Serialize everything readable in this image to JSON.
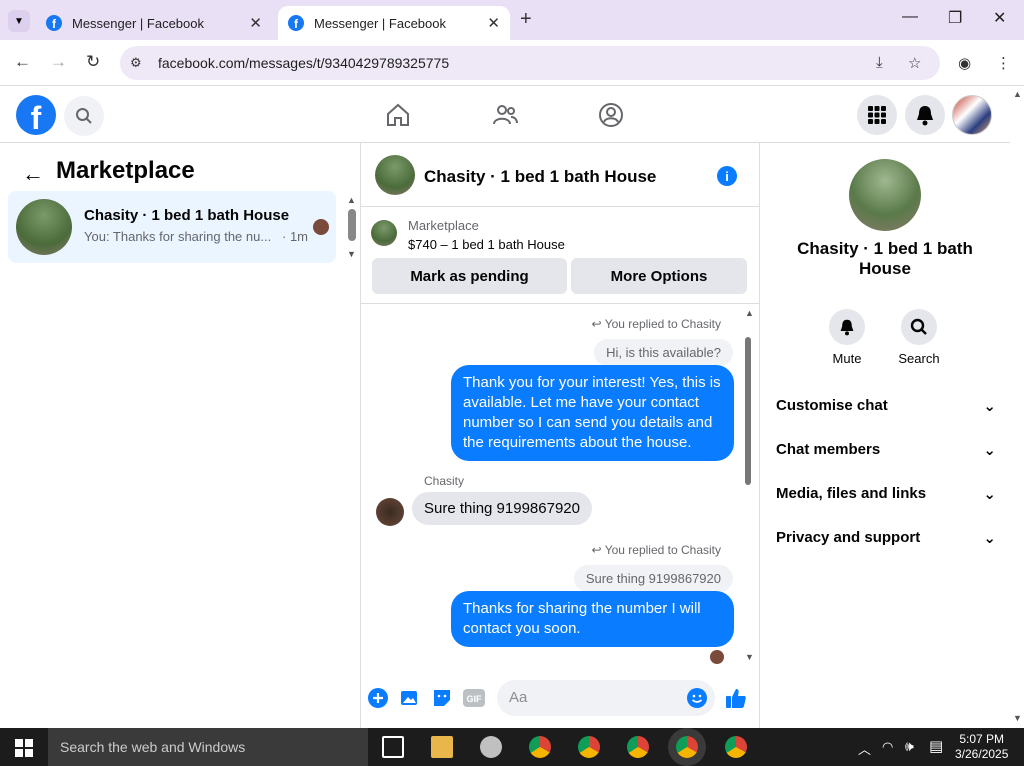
{
  "browser": {
    "tabs": [
      {
        "title": "Messenger | Facebook"
      },
      {
        "title": "Messenger | Facebook"
      }
    ],
    "url": "facebook.com/messages/t/9340429789325775"
  },
  "left_panel": {
    "title": "Marketplace",
    "conversation": {
      "title": "Chasity · 1 bed 1 bath House",
      "preview": "You: Thanks for sharing the nu...",
      "time": "· 1m"
    }
  },
  "chat": {
    "title": "Chasity · 1 bed 1 bath House",
    "listing": {
      "label": "Marketplace",
      "price_title": "$740 – 1 bed 1 bath House"
    },
    "buttons": {
      "pending": "Mark as pending",
      "more": "More Options"
    },
    "messages": {
      "replied1": "You replied to Chasity",
      "quote1": "Hi, is this available?",
      "out1": "Thank you for your interest! Yes, this is available. Let me have your contact number so I can send you details and the requirements about the house.",
      "sender": "Chasity",
      "in1": "Sure thing 9199867920",
      "replied2": "You replied to Chasity",
      "quote2": "Sure thing 9199867920",
      "out2": "Thanks for sharing the number I will contact you soon."
    },
    "composer_placeholder": "Aa"
  },
  "details": {
    "name": "Chasity · 1 bed 1 bath House",
    "actions": {
      "mute": "Mute",
      "search": "Search"
    },
    "sections": [
      "Customise chat",
      "Chat members",
      "Media, files and links",
      "Privacy and support"
    ]
  },
  "taskbar": {
    "search": "Search the web and Windows",
    "time": "5:07 PM",
    "date": "3/26/2025"
  },
  "colors": {
    "messenger_blue": "#0a7cff",
    "facebook_blue": "#1877f2"
  }
}
